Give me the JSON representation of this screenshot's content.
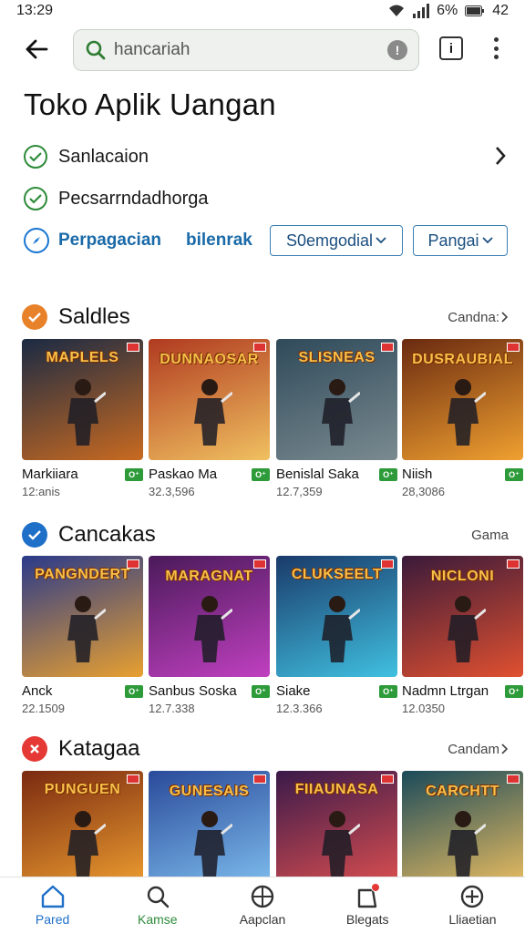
{
  "status": {
    "time": "13:29",
    "battery": "6%",
    "signal_text": "42"
  },
  "search": {
    "value": "hancariah"
  },
  "page_title": "Toko Aplik Uangan",
  "rows": [
    {
      "label": "Sanlacaion"
    },
    {
      "label": "Pecsarrndadhorga"
    }
  ],
  "filters": {
    "primary": "Perpagacian",
    "secondary": "bilenrak",
    "chip1": "S0emgodial",
    "chip2": "Pangai"
  },
  "sections": [
    {
      "title": "Saldles",
      "more": "Candna:",
      "icon": "check-badge-icon",
      "icon_color": "#e8822a",
      "apps": [
        {
          "name": "Markiiara",
          "count": "12:anis",
          "art": "MAPLELS",
          "bg": [
            "#1a2a44",
            "#c96a20"
          ]
        },
        {
          "name": "Paskao Ma",
          "count": "32.3,596",
          "art": "DUNNAOSAR",
          "bg": [
            "#b03a20",
            "#f0c060"
          ]
        },
        {
          "name": "Benislal Saka",
          "count": "12.7,359",
          "art": "SLISNEAS",
          "bg": [
            "#2f4a5a",
            "#7a8a90"
          ]
        },
        {
          "name": "Niish",
          "count": "28,3086",
          "art": "DUSRAUBIAL",
          "bg": [
            "#6a2a10",
            "#f0a030"
          ]
        }
      ]
    },
    {
      "title": "Cancakas",
      "more": "Gama",
      "icon": "checkmark-icon",
      "icon_color": "#1e6fc8",
      "apps": [
        {
          "name": "Anck",
          "count": "22.1509",
          "art": "PANGNDERT",
          "bg": [
            "#2a3a8a",
            "#e8a030"
          ]
        },
        {
          "name": "Sanbus Soska",
          "count": "12.7.338",
          "art": "MARAGNAT",
          "bg": [
            "#4a1a5a",
            "#c040c0"
          ]
        },
        {
          "name": "Siake",
          "count": "12.3.366",
          "art": "CLUKSEELT",
          "bg": [
            "#1a3a6a",
            "#40c0e0"
          ]
        },
        {
          "name": "Nadmn Ltrgan",
          "count": "12.0350",
          "art": "NICLONI",
          "bg": [
            "#3a1a3a",
            "#e05030"
          ]
        }
      ]
    },
    {
      "title": "Katagaa",
      "more": "Candam",
      "icon": "close-x-icon",
      "icon_color": "#e53935",
      "apps": [
        {
          "name": "",
          "count": "",
          "art": "PUNGUEN",
          "bg": [
            "#7a2a10",
            "#f0a030"
          ]
        },
        {
          "name": "",
          "count": "",
          "art": "GUNESAIS",
          "bg": [
            "#2a4a9a",
            "#80c0f0"
          ]
        },
        {
          "name": "",
          "count": "",
          "art": "FIIAUNASA",
          "bg": [
            "#3a1a4a",
            "#e05050"
          ]
        },
        {
          "name": "",
          "count": "",
          "art": "CARCHTT",
          "bg": [
            "#1a4a5a",
            "#f0c060"
          ]
        }
      ]
    }
  ],
  "nav": [
    {
      "label": "Pared",
      "icon": "home-icon"
    },
    {
      "label": "Kamse",
      "icon": "search-icon"
    },
    {
      "label": "Aapclan",
      "icon": "globe-icon"
    },
    {
      "label": "Blegats",
      "icon": "bag-icon"
    },
    {
      "label": "Lliaetian",
      "icon": "plus-circle-icon"
    }
  ]
}
